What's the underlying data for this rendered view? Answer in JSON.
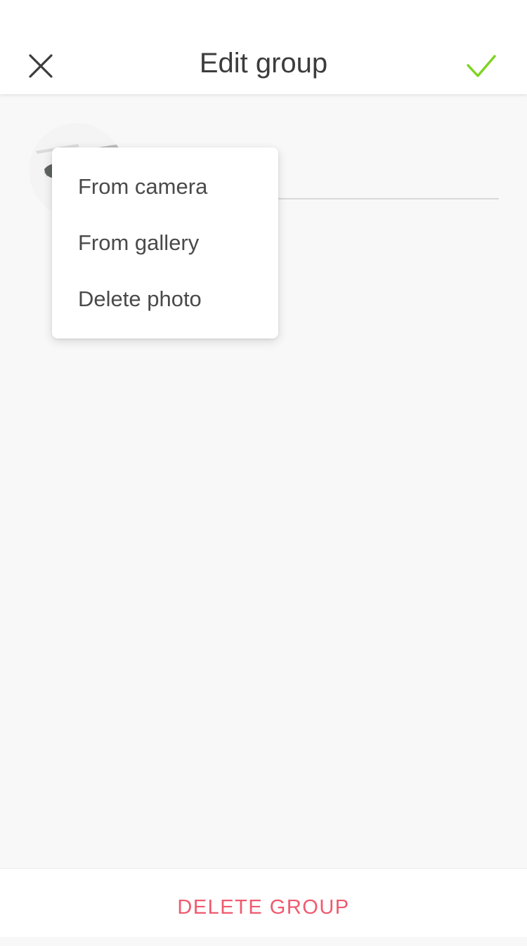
{
  "header": {
    "title": "Edit group",
    "close_icon": "close-icon",
    "confirm_icon": "checkmark-icon"
  },
  "colors": {
    "accent_confirm": "#7ed321",
    "danger": "#f05a6e",
    "background": "#f8f8f8"
  },
  "group": {
    "avatar_icon": "group-avatar-photo",
    "name_value": ""
  },
  "photo_menu": {
    "items": [
      {
        "label": "From camera"
      },
      {
        "label": "From gallery"
      },
      {
        "label": "Delete photo"
      }
    ]
  },
  "footer": {
    "delete_label": "DELETE GROUP"
  }
}
